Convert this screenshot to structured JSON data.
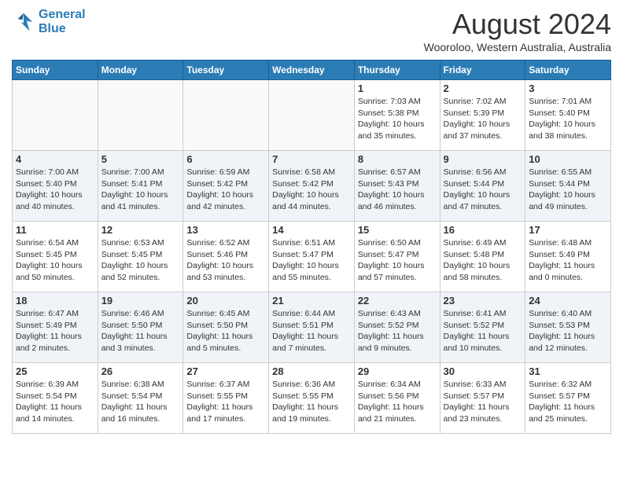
{
  "header": {
    "logo_line1": "General",
    "logo_line2": "Blue",
    "month": "August 2024",
    "location": "Wooroloo, Western Australia, Australia"
  },
  "weekdays": [
    "Sunday",
    "Monday",
    "Tuesday",
    "Wednesday",
    "Thursday",
    "Friday",
    "Saturday"
  ],
  "weeks": [
    [
      {
        "day": "",
        "info": ""
      },
      {
        "day": "",
        "info": ""
      },
      {
        "day": "",
        "info": ""
      },
      {
        "day": "",
        "info": ""
      },
      {
        "day": "1",
        "info": "Sunrise: 7:03 AM\nSunset: 5:38 PM\nDaylight: 10 hours\nand 35 minutes."
      },
      {
        "day": "2",
        "info": "Sunrise: 7:02 AM\nSunset: 5:39 PM\nDaylight: 10 hours\nand 37 minutes."
      },
      {
        "day": "3",
        "info": "Sunrise: 7:01 AM\nSunset: 5:40 PM\nDaylight: 10 hours\nand 38 minutes."
      }
    ],
    [
      {
        "day": "4",
        "info": "Sunrise: 7:00 AM\nSunset: 5:40 PM\nDaylight: 10 hours\nand 40 minutes."
      },
      {
        "day": "5",
        "info": "Sunrise: 7:00 AM\nSunset: 5:41 PM\nDaylight: 10 hours\nand 41 minutes."
      },
      {
        "day": "6",
        "info": "Sunrise: 6:59 AM\nSunset: 5:42 PM\nDaylight: 10 hours\nand 42 minutes."
      },
      {
        "day": "7",
        "info": "Sunrise: 6:58 AM\nSunset: 5:42 PM\nDaylight: 10 hours\nand 44 minutes."
      },
      {
        "day": "8",
        "info": "Sunrise: 6:57 AM\nSunset: 5:43 PM\nDaylight: 10 hours\nand 46 minutes."
      },
      {
        "day": "9",
        "info": "Sunrise: 6:56 AM\nSunset: 5:44 PM\nDaylight: 10 hours\nand 47 minutes."
      },
      {
        "day": "10",
        "info": "Sunrise: 6:55 AM\nSunset: 5:44 PM\nDaylight: 10 hours\nand 49 minutes."
      }
    ],
    [
      {
        "day": "11",
        "info": "Sunrise: 6:54 AM\nSunset: 5:45 PM\nDaylight: 10 hours\nand 50 minutes."
      },
      {
        "day": "12",
        "info": "Sunrise: 6:53 AM\nSunset: 5:45 PM\nDaylight: 10 hours\nand 52 minutes."
      },
      {
        "day": "13",
        "info": "Sunrise: 6:52 AM\nSunset: 5:46 PM\nDaylight: 10 hours\nand 53 minutes."
      },
      {
        "day": "14",
        "info": "Sunrise: 6:51 AM\nSunset: 5:47 PM\nDaylight: 10 hours\nand 55 minutes."
      },
      {
        "day": "15",
        "info": "Sunrise: 6:50 AM\nSunset: 5:47 PM\nDaylight: 10 hours\nand 57 minutes."
      },
      {
        "day": "16",
        "info": "Sunrise: 6:49 AM\nSunset: 5:48 PM\nDaylight: 10 hours\nand 58 minutes."
      },
      {
        "day": "17",
        "info": "Sunrise: 6:48 AM\nSunset: 5:49 PM\nDaylight: 11 hours\nand 0 minutes."
      }
    ],
    [
      {
        "day": "18",
        "info": "Sunrise: 6:47 AM\nSunset: 5:49 PM\nDaylight: 11 hours\nand 2 minutes."
      },
      {
        "day": "19",
        "info": "Sunrise: 6:46 AM\nSunset: 5:50 PM\nDaylight: 11 hours\nand 3 minutes."
      },
      {
        "day": "20",
        "info": "Sunrise: 6:45 AM\nSunset: 5:50 PM\nDaylight: 11 hours\nand 5 minutes."
      },
      {
        "day": "21",
        "info": "Sunrise: 6:44 AM\nSunset: 5:51 PM\nDaylight: 11 hours\nand 7 minutes."
      },
      {
        "day": "22",
        "info": "Sunrise: 6:43 AM\nSunset: 5:52 PM\nDaylight: 11 hours\nand 9 minutes."
      },
      {
        "day": "23",
        "info": "Sunrise: 6:41 AM\nSunset: 5:52 PM\nDaylight: 11 hours\nand 10 minutes."
      },
      {
        "day": "24",
        "info": "Sunrise: 6:40 AM\nSunset: 5:53 PM\nDaylight: 11 hours\nand 12 minutes."
      }
    ],
    [
      {
        "day": "25",
        "info": "Sunrise: 6:39 AM\nSunset: 5:54 PM\nDaylight: 11 hours\nand 14 minutes."
      },
      {
        "day": "26",
        "info": "Sunrise: 6:38 AM\nSunset: 5:54 PM\nDaylight: 11 hours\nand 16 minutes."
      },
      {
        "day": "27",
        "info": "Sunrise: 6:37 AM\nSunset: 5:55 PM\nDaylight: 11 hours\nand 17 minutes."
      },
      {
        "day": "28",
        "info": "Sunrise: 6:36 AM\nSunset: 5:55 PM\nDaylight: 11 hours\nand 19 minutes."
      },
      {
        "day": "29",
        "info": "Sunrise: 6:34 AM\nSunset: 5:56 PM\nDaylight: 11 hours\nand 21 minutes."
      },
      {
        "day": "30",
        "info": "Sunrise: 6:33 AM\nSunset: 5:57 PM\nDaylight: 11 hours\nand 23 minutes."
      },
      {
        "day": "31",
        "info": "Sunrise: 6:32 AM\nSunset: 5:57 PM\nDaylight: 11 hours\nand 25 minutes."
      }
    ]
  ]
}
